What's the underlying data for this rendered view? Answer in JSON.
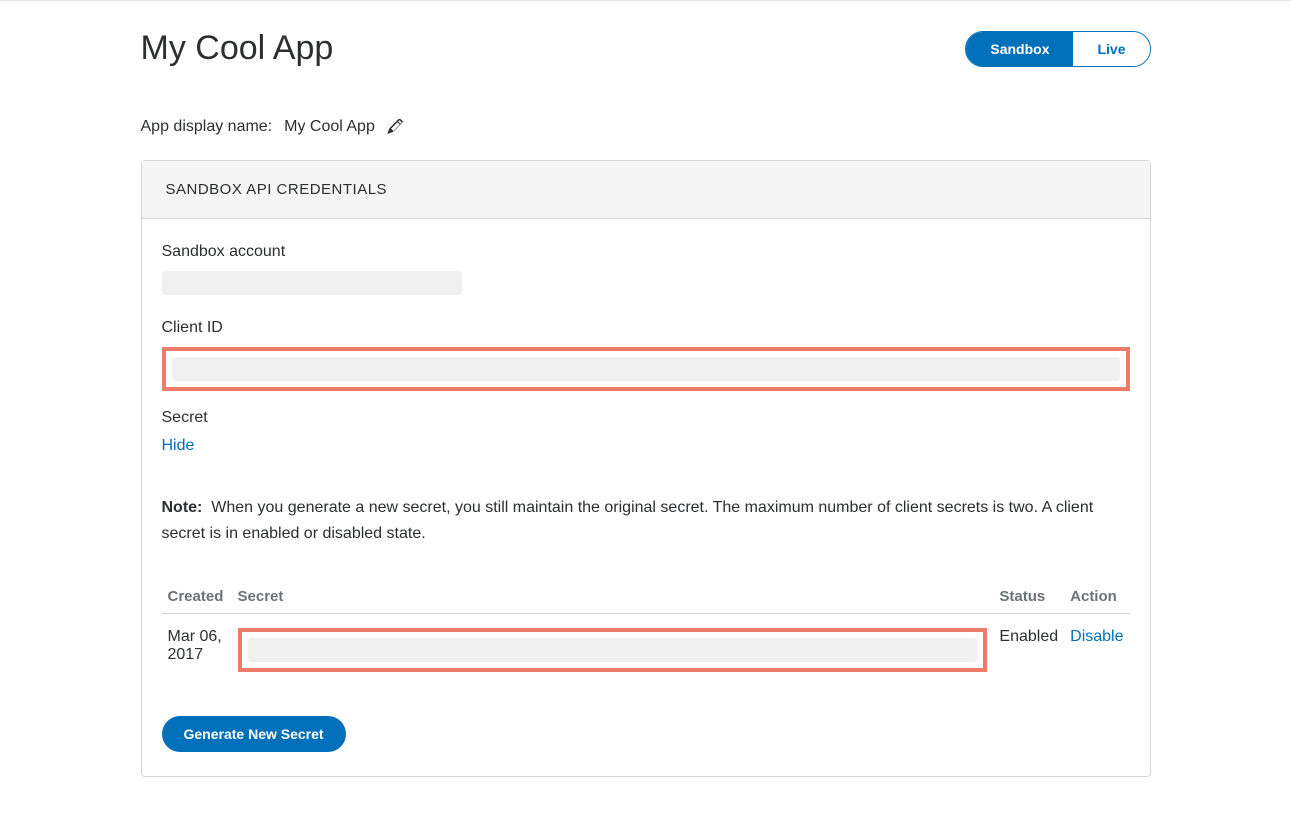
{
  "header": {
    "app_title": "My Cool App",
    "mode_toggle": {
      "sandbox": "Sandbox",
      "live": "Live"
    }
  },
  "display_name": {
    "label": "App display name:",
    "value": "My Cool App"
  },
  "panel": {
    "title": "SANDBOX API CREDENTIALS",
    "sandbox_account_label": "Sandbox account",
    "client_id_label": "Client ID",
    "secret_label": "Secret",
    "hide_link": "Hide",
    "note_label": "Note:",
    "note_text": "When you generate a new secret, you still maintain the original secret. The maximum number of client secrets is two. A client secret is in enabled or disabled state."
  },
  "table": {
    "headers": {
      "created": "Created",
      "secret": "Secret",
      "status": "Status",
      "action": "Action"
    },
    "rows": [
      {
        "created": "Mar 06, 2017",
        "status": "Enabled",
        "action": "Disable"
      }
    ]
  },
  "buttons": {
    "generate_secret": "Generate New Secret"
  }
}
